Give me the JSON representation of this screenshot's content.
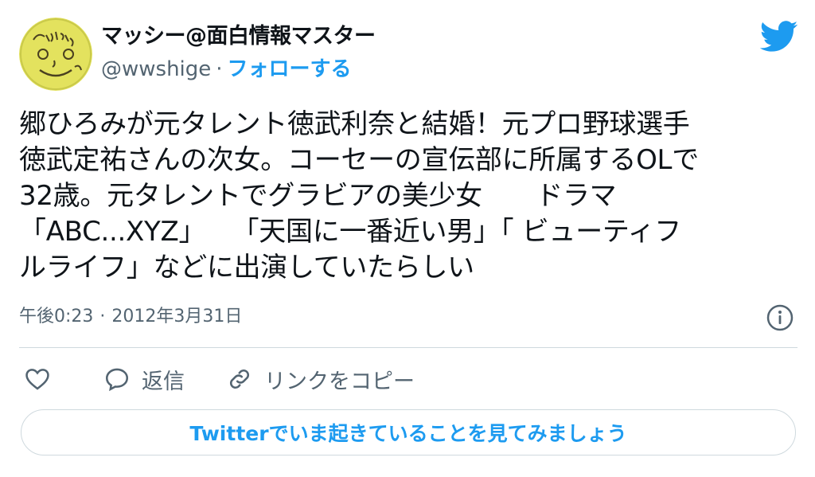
{
  "author": {
    "display_name": "マッシー@面白情報マスター",
    "handle": "@wwshige",
    "separator": "·",
    "follow_label": "フォローする"
  },
  "tweet": {
    "text": "郷ひろみが元タレント徳武利奈と結婚！元プロ野球選手\n徳武定祐さんの次女。コーセーの宣伝部に所属するOLで\n32歳。元タレントでグラビアの美少女　　ドラマ\n「ABC...XYZ」　　「天国に一番近い男」「 ビューティフ\nルライフ」などに出演していたらしい",
    "time": "午後0:23",
    "meta_separator": "·",
    "date": "2012年3月31日"
  },
  "actions": {
    "like_label": "",
    "reply_label": "返信",
    "copy_link_label": "リンクをコピー"
  },
  "cta": {
    "label": "Twitterでいま起きていることを見てみましょう"
  },
  "colors": {
    "accent": "#1d9bf0",
    "text": "#0f1419",
    "muted": "#536471",
    "border": "#cfd9de",
    "avatar_bg": "#dfe05a"
  },
  "icons": {
    "brand": "twitter-bird-icon",
    "info": "info-icon",
    "like": "heart-icon",
    "reply": "speech-bubble-icon",
    "copy_link": "link-icon"
  }
}
